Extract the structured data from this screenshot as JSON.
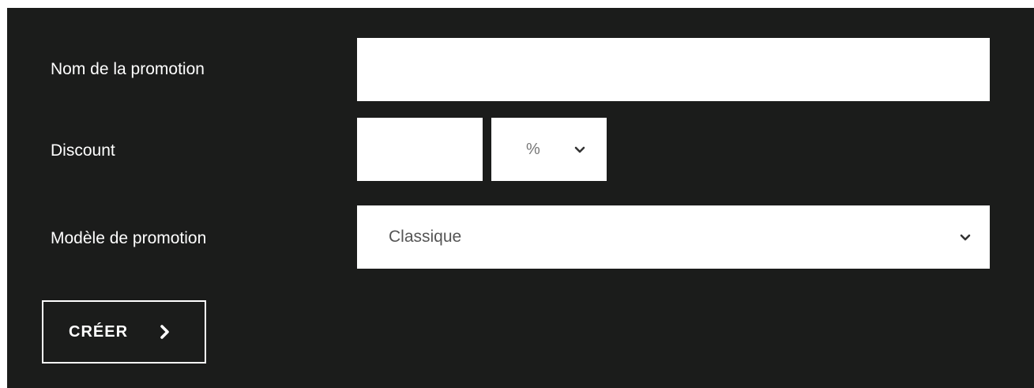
{
  "form": {
    "name_label": "Nom de la promotion",
    "name_value": "",
    "discount_label": "Discount",
    "discount_value": "",
    "discount_unit": "%",
    "model_label": "Modèle de promotion",
    "model_value": "Classique",
    "submit_label": "CRÉER"
  },
  "icons": {
    "unit_chevron": "chevron-down-icon",
    "model_chevron": "chevron-down-icon",
    "submit_arrow": "chevron-right-icon"
  },
  "colors": {
    "background": "#1b1c1b",
    "field": "#ffffff",
    "text": "#ffffff"
  }
}
